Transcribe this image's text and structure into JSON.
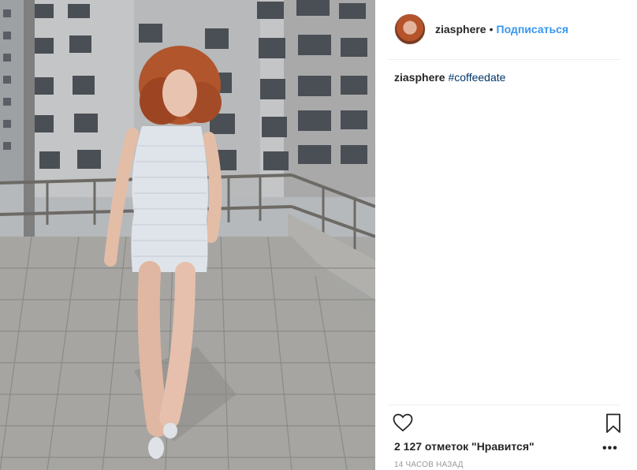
{
  "post": {
    "username": "ziasphere",
    "separator": "•",
    "follow_label": "Подписаться",
    "caption_username": "ziasphere",
    "caption_hashtag": "#coffeedate",
    "likes_text": "2 127 отметок \"Нравится\"",
    "timestamp": "14 ЧАСОВ НАЗАД",
    "more_label": "•••"
  },
  "icons": {
    "like": "heart-icon",
    "save": "bookmark-icon",
    "options": "more-options-icon"
  },
  "colors": {
    "follow_blue": "#3897f0",
    "hashtag": "#003569",
    "text": "#262626",
    "muted": "#999999",
    "border": "#efefef"
  }
}
